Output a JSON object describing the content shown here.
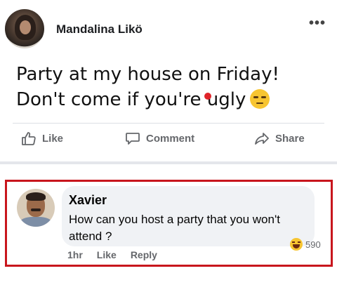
{
  "post": {
    "author": "Mandalina Likö",
    "more_icon": "more-horizontal-icon",
    "more_label": "•••",
    "text_line1": "Party at my house on Friday!",
    "text_line2": "Don't come if you're ugly",
    "emoji": "unamused-face-emoji"
  },
  "actions": {
    "like": "Like",
    "comment": "Comment",
    "share": "Share"
  },
  "comment": {
    "author": "Xavier",
    "text": "How can you host a party that you won't attend ?",
    "time": "1hr",
    "like": "Like",
    "reply": "Reply",
    "reaction_icon": "haha-icon",
    "reaction_count": "590"
  },
  "colors": {
    "highlight_border": "#c8161d",
    "action_gray": "#65676b",
    "bubble_bg": "#f0f2f5"
  }
}
